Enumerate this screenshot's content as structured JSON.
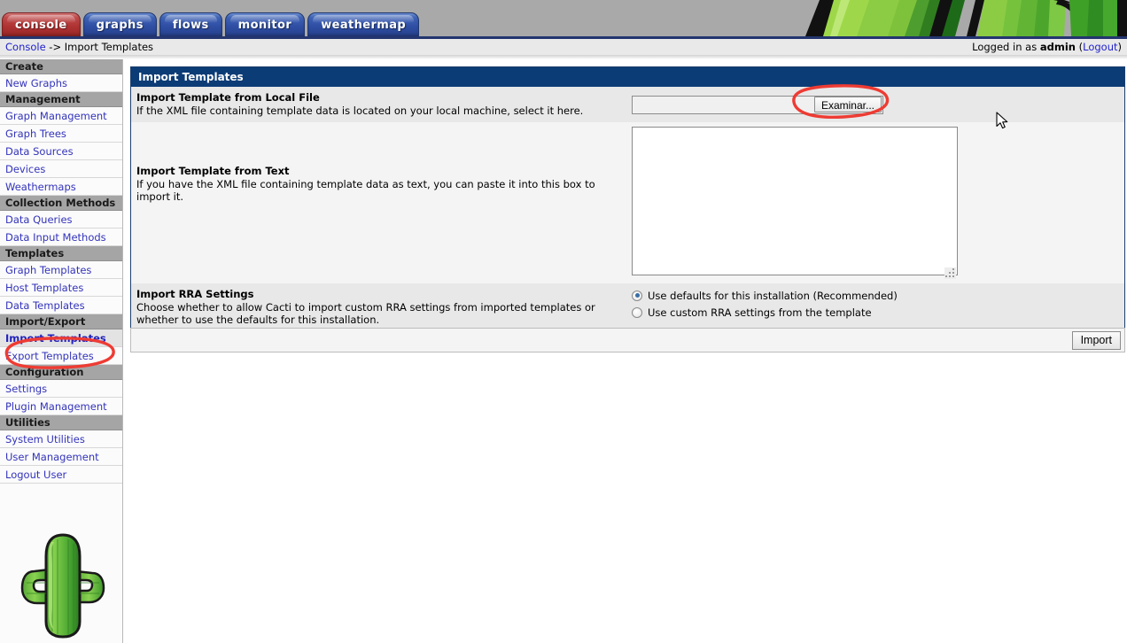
{
  "window": {
    "title": "Import Templates"
  },
  "tabs": [
    {
      "label": "console",
      "state": "active",
      "color": "#b03434"
    },
    {
      "label": "graphs",
      "state": "inactive",
      "color": "#2f4fa5"
    },
    {
      "label": "flows",
      "state": "inactive",
      "color": "#2f4fa5"
    },
    {
      "label": "monitor",
      "state": "inactive",
      "color": "#2f4fa5"
    },
    {
      "label": "weathermap",
      "state": "inactive",
      "color": "#2f4fa5"
    }
  ],
  "breadcrumb": {
    "root_link": "Console",
    "separator": " -> ",
    "current": "Import Templates",
    "login_prefix": "Logged in as ",
    "login_user": "admin",
    "login_open_paren": " (",
    "logout_link": "Logout",
    "login_close_paren": ")"
  },
  "sidebar": {
    "sections": [
      {
        "header": "Create",
        "items": [
          {
            "label": "New Graphs",
            "active": false
          }
        ]
      },
      {
        "header": "Management",
        "items": [
          {
            "label": "Graph Management",
            "active": false
          },
          {
            "label": "Graph Trees",
            "active": false
          },
          {
            "label": "Data Sources",
            "active": false
          },
          {
            "label": "Devices",
            "active": false
          },
          {
            "label": "Weathermaps",
            "active": false
          }
        ]
      },
      {
        "header": "Collection Methods",
        "items": [
          {
            "label": "Data Queries",
            "active": false
          },
          {
            "label": "Data Input Methods",
            "active": false
          }
        ]
      },
      {
        "header": "Templates",
        "items": [
          {
            "label": "Graph Templates",
            "active": false
          },
          {
            "label": "Host Templates",
            "active": false
          },
          {
            "label": "Data Templates",
            "active": false
          }
        ]
      },
      {
        "header": "Import/Export",
        "items": [
          {
            "label": "Import Templates",
            "active": true
          },
          {
            "label": "Export Templates",
            "active": false
          }
        ]
      },
      {
        "header": "Configuration",
        "items": [
          {
            "label": "Settings",
            "active": false
          },
          {
            "label": "Plugin Management",
            "active": false
          }
        ]
      },
      {
        "header": "Utilities",
        "items": [
          {
            "label": "System Utilities",
            "active": false
          },
          {
            "label": "User Management",
            "active": false
          },
          {
            "label": "Logout User",
            "active": false
          }
        ]
      }
    ],
    "logo": "cactus-logo"
  },
  "main": {
    "panel_title": "Import Templates",
    "rows": {
      "local_file": {
        "heading": "Import Template from Local File",
        "description": "If the XML file containing template data is located on your local machine, select it here.",
        "input_value": "",
        "browse_button": "Examinar..."
      },
      "from_text": {
        "heading": "Import Template from Text",
        "description": "If you have the XML file containing template data as text, you can paste it into this box to import it.",
        "textarea_value": "",
        "textarea_placeholder": ""
      },
      "rra_settings": {
        "heading": "Import RRA Settings",
        "description": "Choose whether to allow Cacti to import custom RRA settings from imported templates or whether to use the defaults for this installation.",
        "options": [
          {
            "label": "Use defaults for this installation (Recommended)",
            "selected": true
          },
          {
            "label": "Use custom RRA settings from the template",
            "selected": false
          }
        ]
      }
    },
    "import_button": "Import"
  },
  "annotations": {
    "ellipse_browse_button": "red-ellipse-highlight",
    "ellipse_sidebar_import": "red-ellipse-highlight",
    "color": "#ee3b33"
  }
}
